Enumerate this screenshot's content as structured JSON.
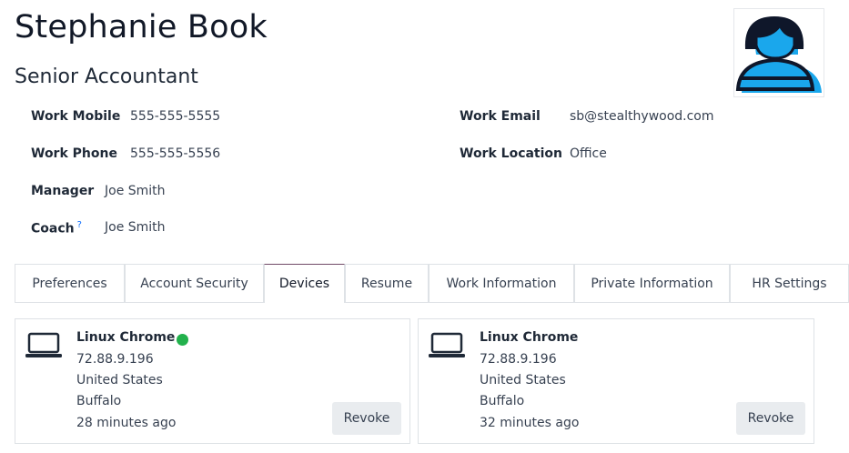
{
  "employee": {
    "name": "Stephanie Book",
    "job_title": "Senior Accountant"
  },
  "fields": {
    "work_mobile": {
      "label": "Work Mobile",
      "value": "555-555-5555"
    },
    "work_phone": {
      "label": "Work Phone",
      "value": "555-555-5556"
    },
    "manager": {
      "label": "Manager",
      "value": "Joe Smith"
    },
    "coach": {
      "label": "Coach",
      "help": "?",
      "value": "Joe Smith"
    },
    "work_email": {
      "label": "Work Email",
      "value": "sb@stealthywood.com"
    },
    "work_location": {
      "label": "Work Location",
      "value": "Office"
    }
  },
  "tabs": [
    {
      "label": "Preferences"
    },
    {
      "label": "Account Security"
    },
    {
      "label": "Devices",
      "active": true
    },
    {
      "label": "Resume"
    },
    {
      "label": "Work Information"
    },
    {
      "label": "Private Information"
    },
    {
      "label": "HR Settings"
    }
  ],
  "devices": [
    {
      "icon": "laptop-icon",
      "name": "Linux Chrome",
      "online": true,
      "online_color": "#22b14c",
      "ip": "72.88.9.196",
      "country": "United States",
      "city": "Buffalo",
      "last_active": "28 minutes ago",
      "action": "Revoke"
    },
    {
      "icon": "laptop-icon",
      "name": "Linux Chrome",
      "online": false,
      "ip": "72.88.9.196",
      "country": "United States",
      "city": "Buffalo",
      "last_active": "32 minutes ago",
      "action": "Revoke"
    }
  ],
  "colors": {
    "accent": "#714b67",
    "avatar_blue": "#1aa7ec",
    "avatar_dark": "#0f172a"
  }
}
